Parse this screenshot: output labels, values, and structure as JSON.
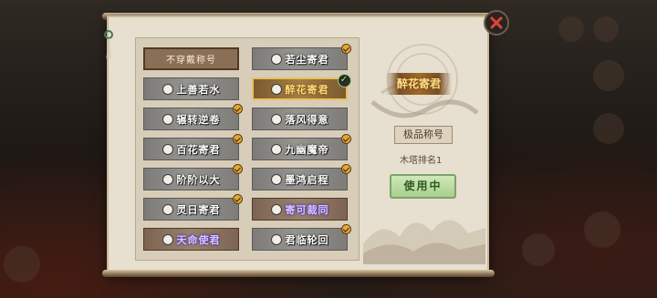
{
  "colors": {
    "scroll_paper": "#e7dfcf",
    "selected_gold": "#e8c15c",
    "use_button_green": "#a9cf8f",
    "close_x_red": "#e0443a"
  },
  "titles": [
    {
      "label": "不穿戴称号",
      "style": "plain",
      "badge": "none"
    },
    {
      "label": "若尘寄君",
      "style": "grey",
      "badge": "gold"
    },
    {
      "label": "上善若水",
      "style": "grey",
      "badge": "none"
    },
    {
      "label": "醉花寄君",
      "style": "gold",
      "badge": "check"
    },
    {
      "label": "辗转逆卷",
      "style": "grey",
      "badge": "gold"
    },
    {
      "label": "落风得意",
      "style": "grey",
      "badge": "none"
    },
    {
      "label": "百花寄君",
      "style": "grey",
      "badge": "gold"
    },
    {
      "label": "九幽魔帝",
      "style": "grey",
      "badge": "gold"
    },
    {
      "label": "阶阶以大",
      "style": "grey",
      "badge": "gold"
    },
    {
      "label": "墨鸿启程",
      "style": "grey",
      "badge": "gold"
    },
    {
      "label": "灵日寄君",
      "style": "grey",
      "badge": "gold"
    },
    {
      "label": "寄可裁同",
      "style": "brown-purple",
      "badge": "none"
    },
    {
      "label": "天命使君",
      "style": "brown-purple",
      "badge": "none"
    },
    {
      "label": "君临轮回",
      "style": "grey",
      "badge": "gold"
    }
  ],
  "preview": {
    "emblem_text": "醉花寄君",
    "rarity": "极品称号",
    "rank": "木塔排名1",
    "use_button": "使用中"
  },
  "close_icon": "close-icon"
}
